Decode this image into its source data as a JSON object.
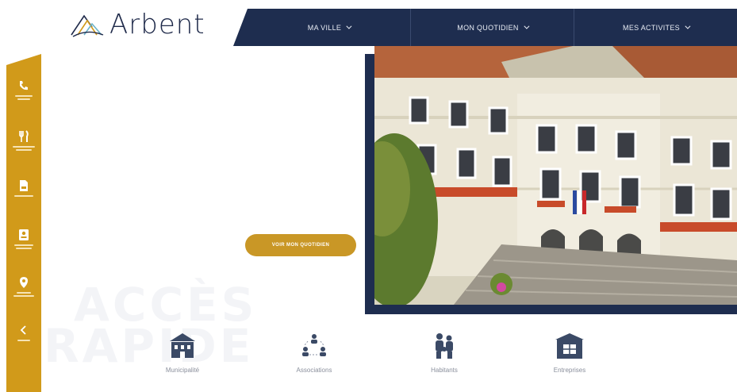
{
  "brand": {
    "name": "Arbent"
  },
  "nav": {
    "items": [
      {
        "label": "MA VILLE"
      },
      {
        "label": "MON QUOTIDIEN"
      },
      {
        "label": "MES ACTIVITES"
      }
    ]
  },
  "sidebar": {
    "items": [
      {
        "icon": "phone-icon"
      },
      {
        "icon": "restaurant-icon"
      },
      {
        "icon": "document-icon"
      },
      {
        "icon": "badge-icon"
      },
      {
        "icon": "location-pin-icon"
      },
      {
        "icon": "chevron-left-icon"
      }
    ]
  },
  "hero": {
    "cta_label": "VOIR MON QUOTIDIEN"
  },
  "quick_access": {
    "watermark_line1": "ACCÈS",
    "watermark_line2": "RAPIDE",
    "tiles": [
      {
        "label": "Municipalité",
        "icon": "town-hall-icon"
      },
      {
        "label": "Associations",
        "icon": "network-icon"
      },
      {
        "label": "Habitants",
        "icon": "family-icon"
      },
      {
        "label": "Entreprises",
        "icon": "building-icon"
      }
    ]
  },
  "colors": {
    "navy": "#1e2d4f",
    "gold": "#d19a1a",
    "cta": "#c99726"
  }
}
